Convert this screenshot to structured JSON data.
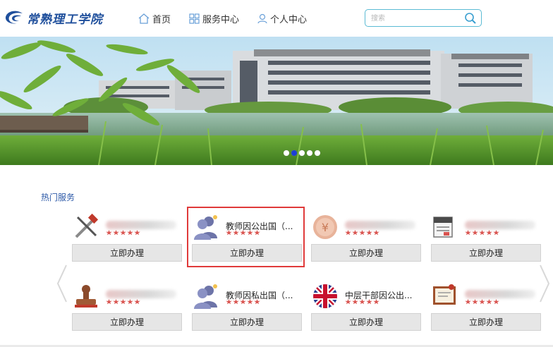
{
  "header": {
    "logo_text": "常熟理工学院",
    "nav": [
      {
        "label": "首页",
        "icon": "home-icon"
      },
      {
        "label": "服务中心",
        "icon": "grid-icon"
      },
      {
        "label": "个人中心",
        "icon": "user-icon"
      }
    ],
    "search": {
      "placeholder": "搜索",
      "icon": "search-icon"
    }
  },
  "banner": {
    "slide_count": 5,
    "active_slide": 1
  },
  "section": {
    "title": "热门服务"
  },
  "services": [
    {
      "name": "",
      "icon": "tools-icon",
      "rating": 5,
      "button": "立即办理"
    },
    {
      "name": "教师因公出国（...",
      "icon": "users-icon",
      "rating": 5,
      "button": "立即办理"
    },
    {
      "name": "",
      "icon": "coin-icon",
      "rating": 5,
      "button": "立即办理"
    },
    {
      "name": "",
      "icon": "news-icon",
      "rating": 5,
      "button": "立即办理"
    },
    {
      "name": "",
      "icon": "stamp-icon",
      "rating": 5,
      "button": "立即办理"
    },
    {
      "name": "教师因私出国（...",
      "icon": "users-icon",
      "rating": 5,
      "button": "立即办理"
    },
    {
      "name": "中层干部因公出...",
      "icon": "uk-flag-icon",
      "rating": 5,
      "button": "立即办理"
    },
    {
      "name": "",
      "icon": "certificate-icon",
      "rating": 5,
      "button": "立即办理"
    }
  ],
  "colors": {
    "accent": "#2e5aa8",
    "highlight_border": "#e03a3a",
    "star": "#d9534f",
    "search_border": "#5bbbd4"
  }
}
